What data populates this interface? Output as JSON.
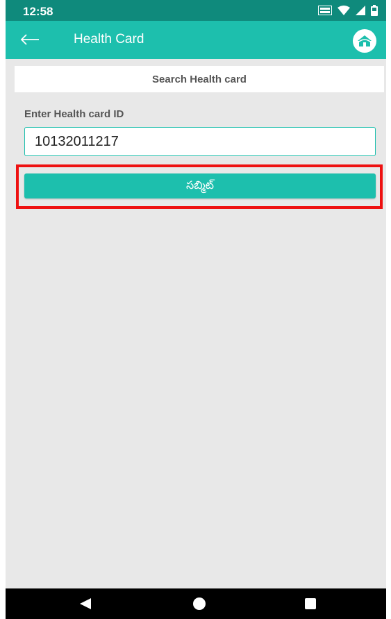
{
  "status_bar": {
    "time": "12:58",
    "icons": [
      "volte-icon",
      "wifi-icon",
      "signal-icon",
      "battery-icon"
    ]
  },
  "app_bar": {
    "title": "Health Card",
    "back_icon": "back-arrow-icon",
    "home_icon": "home-icon",
    "color": "#1dbfad"
  },
  "search": {
    "header": "Search Health card",
    "field_label": "Enter Health card ID",
    "input_value": "10132011217"
  },
  "submit": {
    "label": "సబ్మిట్",
    "highlight_color": "#ee1111"
  },
  "nav_bar": {
    "icons": [
      "back-triangle-icon",
      "home-circle-icon",
      "recents-square-icon"
    ]
  }
}
